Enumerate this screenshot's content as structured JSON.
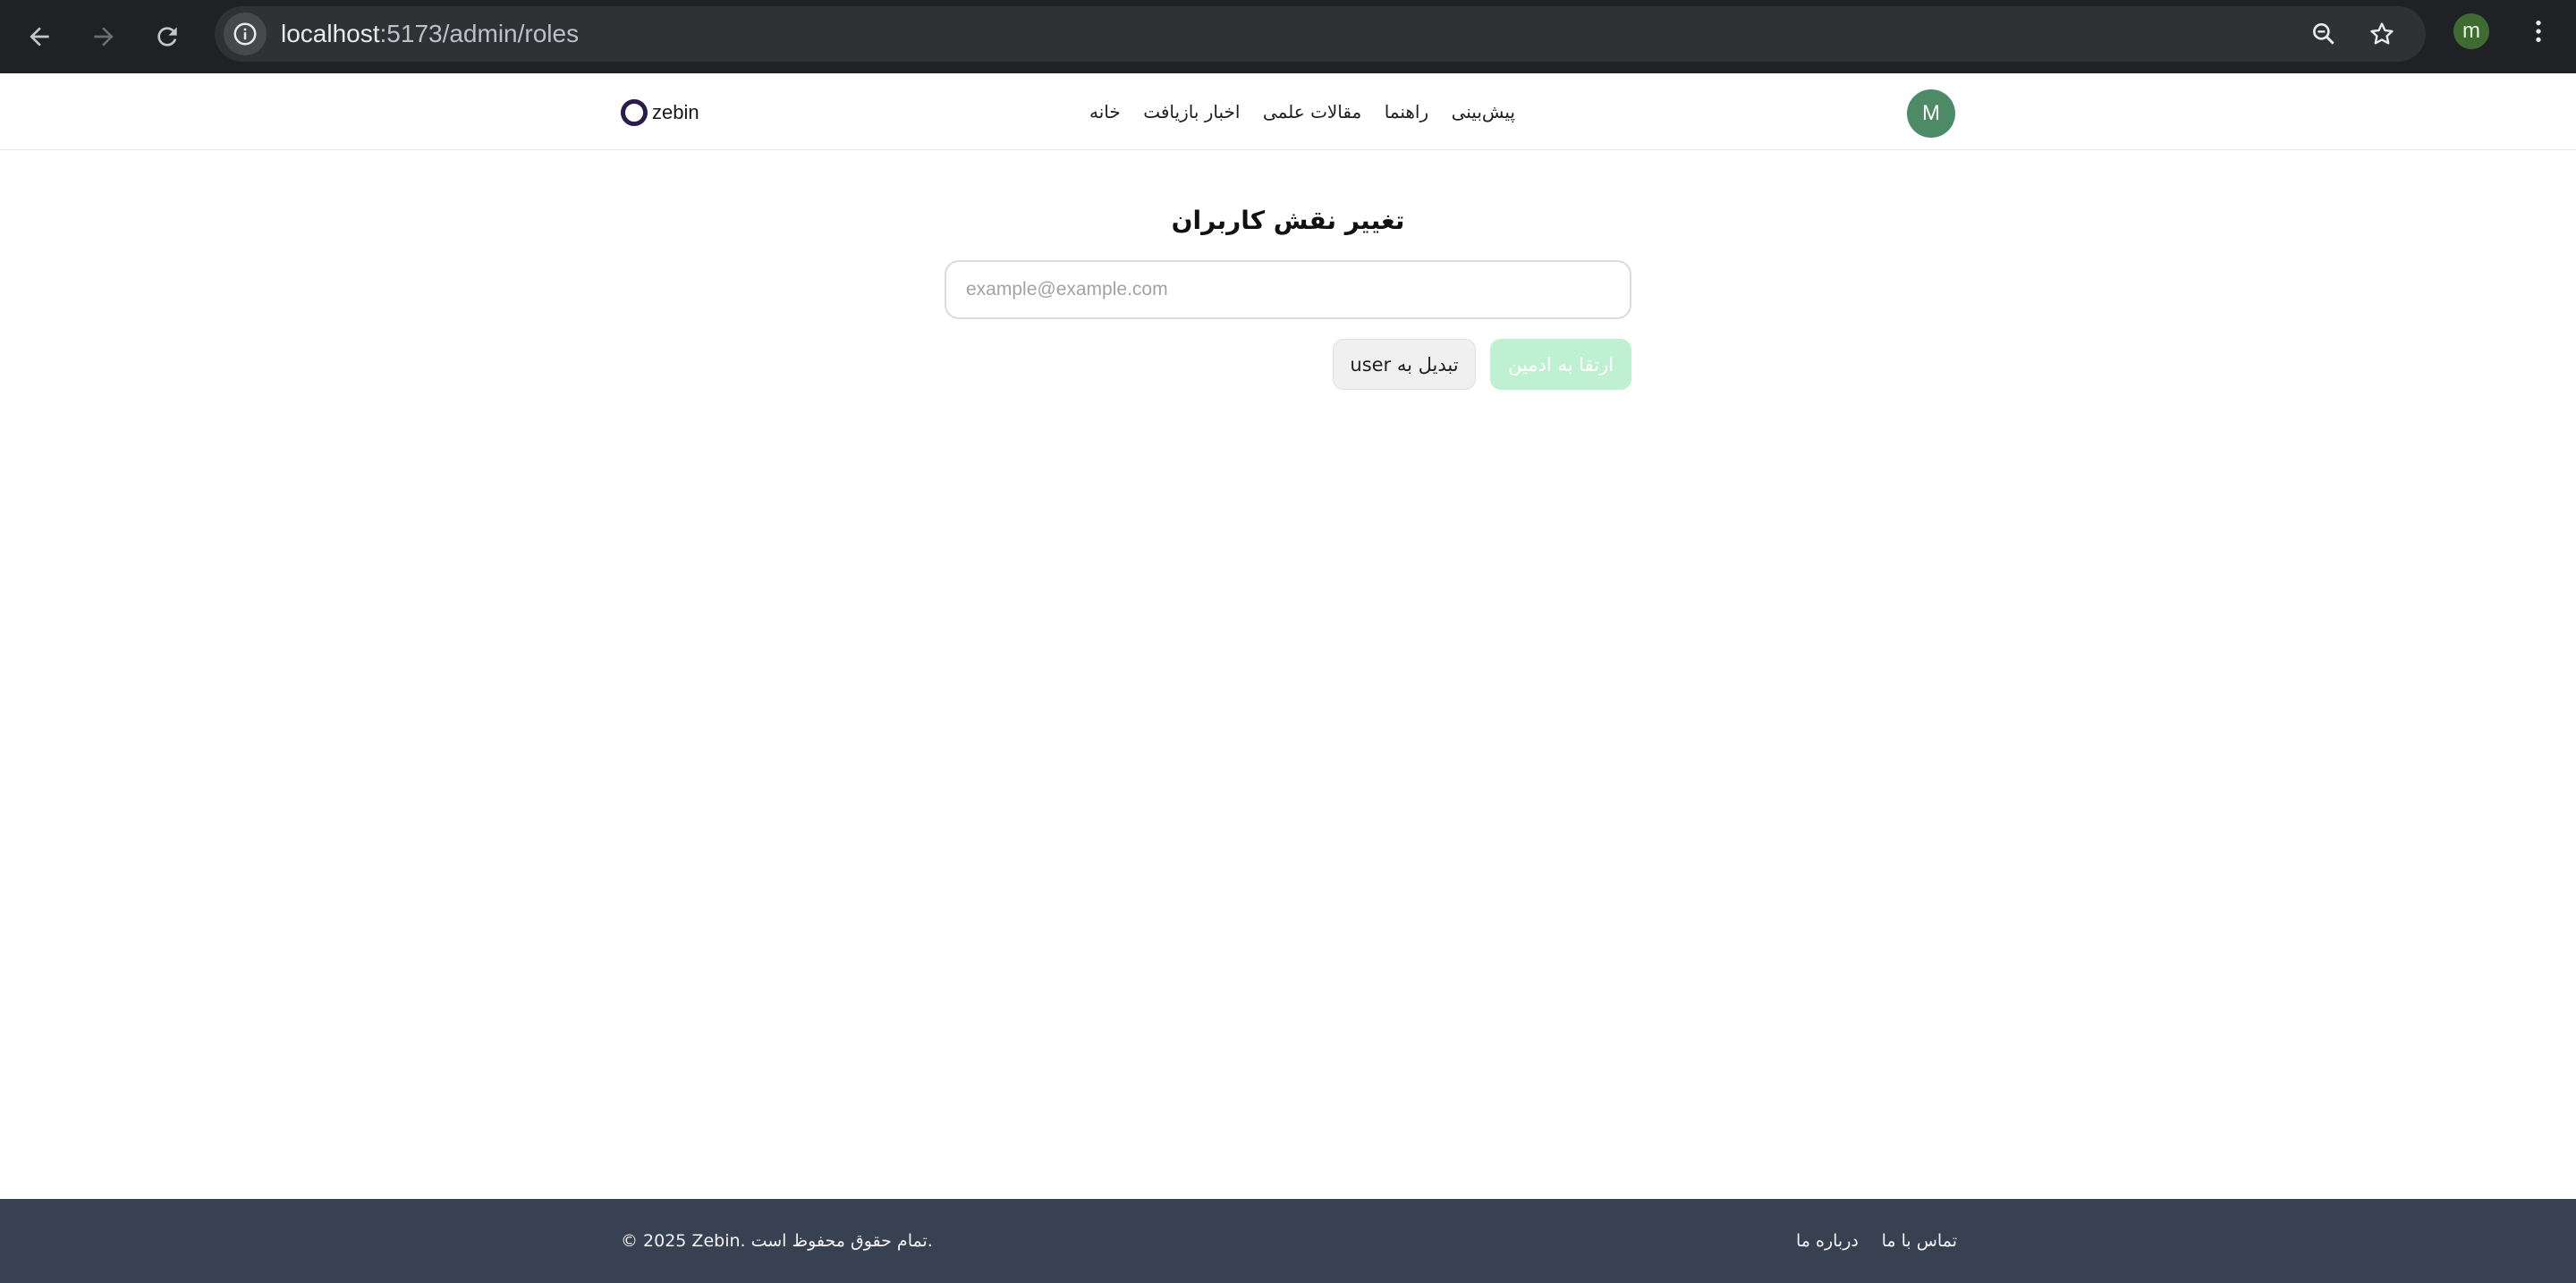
{
  "browser": {
    "url_host": "localhost",
    "url_path": ":5173/admin/roles",
    "profile_initial": "m",
    "icons": [
      "back-arrow-icon",
      "forward-arrow-icon",
      "reload-icon",
      "site-info-icon",
      "zoom-icon",
      "bookmark-star-icon",
      "more-menu-icon"
    ]
  },
  "header": {
    "logo_text": "zebin",
    "nav": [
      "خانه",
      "اخبار بازیافت",
      "مقالات علمی",
      "راهنما",
      "پیش‌بینی"
    ],
    "avatar_initial": "M"
  },
  "main": {
    "title": "تغییر نقش کاربران",
    "email_placeholder": "example@example.com",
    "email_value": "",
    "promote_button": "ارتقا به ادمین",
    "demote_button": "تبدیل به user"
  },
  "footer": {
    "copyright": "© 2025 Zebin. تمام حقوق محفوظ است.",
    "links": [
      "درباره ما",
      "تماس با ما"
    ]
  },
  "colors": {
    "chrome_bg": "#202124",
    "avatar_bg": "#4d8b67",
    "promote_button_bg": "#bff0d2",
    "footer_bg": "#384152"
  }
}
